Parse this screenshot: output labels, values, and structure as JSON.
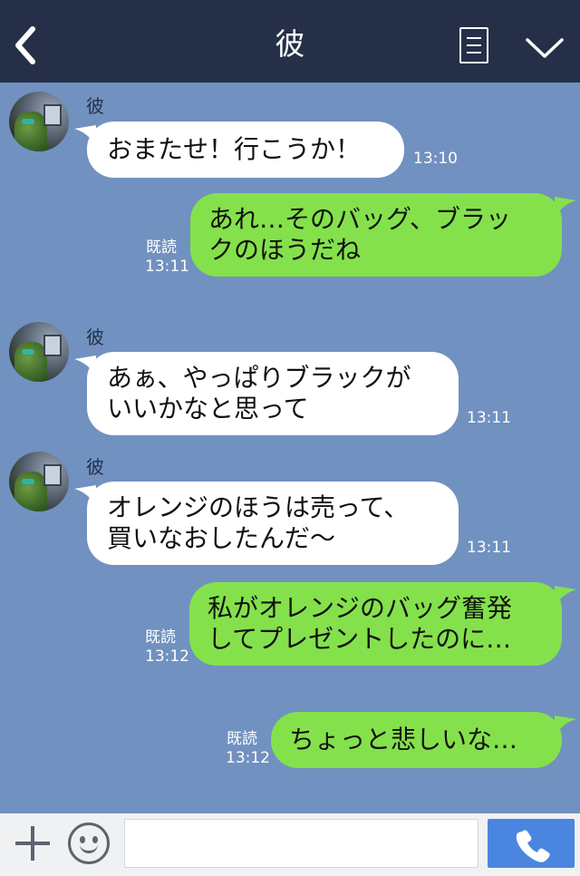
{
  "header": {
    "title": "彼",
    "back_icon": "chevron-left-icon",
    "menu_icon": "note-list-icon",
    "collapse_icon": "chevron-down-icon"
  },
  "messages": [
    {
      "direction": "in",
      "sender": "彼",
      "lines": [
        "おまたせ！行こうか！"
      ],
      "time": "13:10"
    },
    {
      "direction": "out",
      "lines": [
        "あれ…そのバッグ、ブラッ",
        "クのほうだね"
      ],
      "read": "既読",
      "time": "13:11"
    },
    {
      "direction": "in",
      "sender": "彼",
      "lines": [
        "あぁ、やっぱりブラックが",
        "いいかなと思って"
      ],
      "time": "13:11"
    },
    {
      "direction": "in",
      "sender": "彼",
      "lines": [
        "オレンジのほうは売って、",
        "買いなおしたんだ〜"
      ],
      "time": "13:11"
    },
    {
      "direction": "out",
      "lines": [
        "私がオレンジのバッグ奮発",
        "してプレゼントしたのに…"
      ],
      "read": "既読",
      "time": "13:12"
    },
    {
      "direction": "out",
      "lines": [
        "ちょっと悲しいな…"
      ],
      "read": "既読",
      "time": "13:12"
    }
  ],
  "input_bar": {
    "plus_icon": "plus-icon",
    "emoji_icon": "smiley-icon",
    "message_value": "",
    "message_placeholder": "",
    "call_icon": "phone-icon"
  },
  "colors": {
    "header_bg": "#253048",
    "chat_bg": "#7191c0",
    "incoming_bubble": "#ffffff",
    "outgoing_bubble": "#84e14b",
    "call_button": "#4a86e0"
  }
}
